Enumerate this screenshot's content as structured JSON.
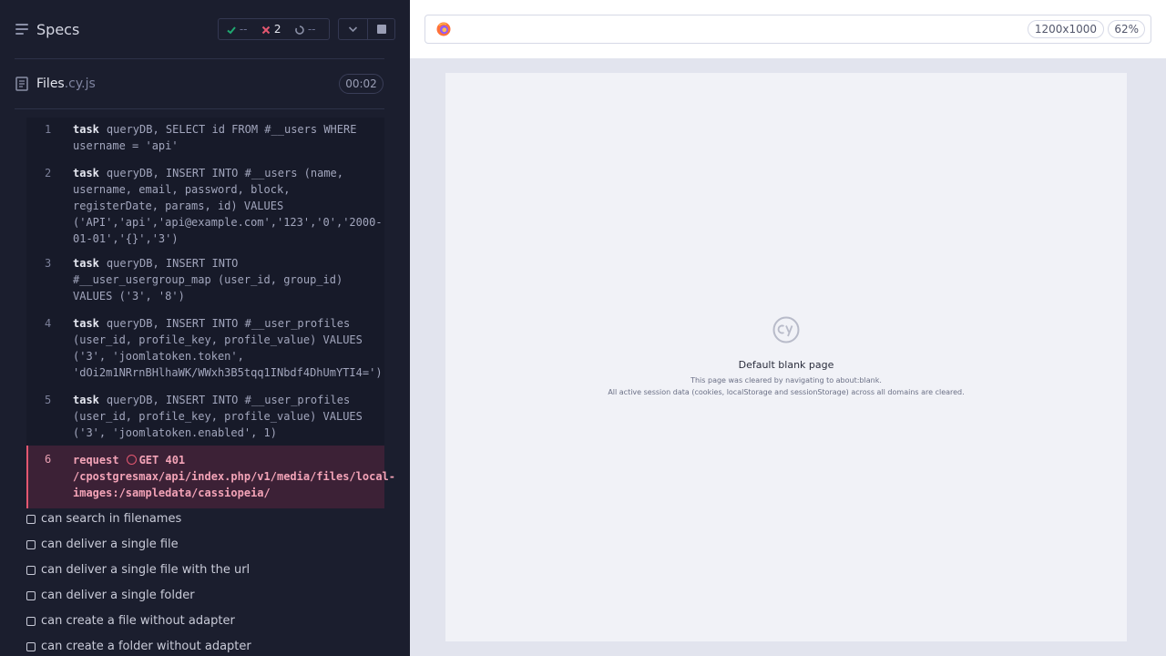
{
  "header": {
    "title": "Specs",
    "stats": {
      "passed": "--",
      "failed": "2",
      "pending": "--"
    }
  },
  "file": {
    "name": "Files",
    "ext": ".cy.js",
    "duration": "00:02"
  },
  "commands": [
    {
      "num": "1",
      "name": "task",
      "message": "queryDB, SELECT id FROM #__users WHERE username = 'api'",
      "state": "passed"
    },
    {
      "num": "2",
      "name": "task",
      "message": "queryDB, INSERT INTO #__users (name, username, email, password, block, registerDate, params, id) VALUES ('API','api','api@example.com','123','0','2000-01-01','{}','3')",
      "state": "passed"
    },
    {
      "num": "3",
      "name": "task",
      "message": "queryDB, INSERT INTO #__user_usergroup_map (user_id, group_id) VALUES ('3', '8')",
      "state": "passed"
    },
    {
      "num": "4",
      "name": "task",
      "message": "queryDB, INSERT INTO #__user_profiles (user_id, profile_key, profile_value) VALUES ('3', 'joomlatoken.token', 'dOi2m1NRrnBHlhaWK/WWxh3B5tqq1INbdf4DhUmYTI4=')",
      "state": "passed"
    },
    {
      "num": "5",
      "name": "task",
      "message": "queryDB, INSERT INTO #__user_profiles (user_id, profile_key, profile_value) VALUES ('3', 'joomlatoken.enabled', 1)",
      "state": "passed"
    },
    {
      "num": "6",
      "name": "request",
      "message": "GET 401 /cpostgresmax/api/index.php/v1/media/files/local-images:/sampledata/cassiopeia/",
      "state": "failed"
    }
  ],
  "tests": [
    "can search in filenames",
    "can deliver a single file",
    "can deliver a single file with the url",
    "can deliver a single folder",
    "can create a file without adapter",
    "can create a folder without adapter"
  ],
  "aut": {
    "viewport": "1200x1000",
    "zoom": "62%",
    "blank_title": "Default blank page",
    "blank_line1": "This page was cleared by navigating to about:blank.",
    "blank_line2": "All active session data (cookies, localStorage and sessionStorage) across all domains are cleared."
  },
  "colors": {
    "failed": "#e45770",
    "passed": "#1fa971",
    "panel": "#1b1e2e",
    "aut_bg": "#e2e4ee"
  }
}
